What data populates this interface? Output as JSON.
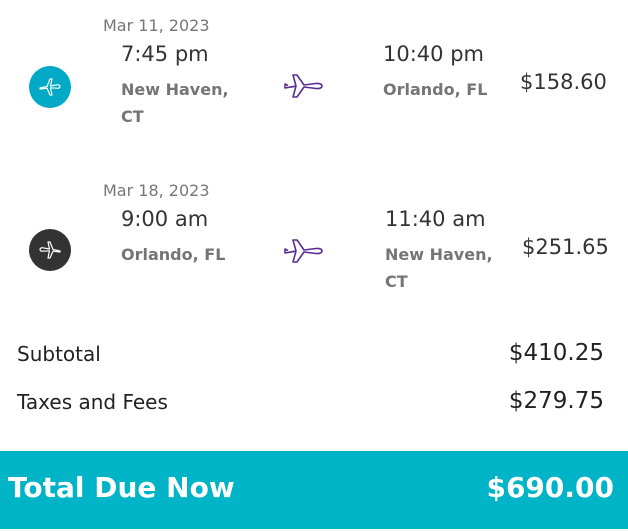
{
  "flights": [
    {
      "date": "Mar 11, 2023",
      "depart_time": "7:45 pm",
      "depart_city_line1": "New Haven,",
      "depart_city_line2": "CT",
      "arrive_time": "10:40 pm",
      "arrive_city_line1": "Orlando, FL",
      "arrive_city_line2": "",
      "price": "$158.60",
      "icon": "plane-departure-icon",
      "icon_color": "#00a9c5"
    },
    {
      "date": "Mar 18, 2023",
      "depart_time": "9:00 am",
      "depart_city_line1": "Orlando, FL",
      "depart_city_line2": "",
      "arrive_time": "11:40 am",
      "arrive_city_line1": "New Haven,",
      "arrive_city_line2": "CT",
      "price": "$251.65",
      "icon": "plane-return-icon",
      "icon_color": "#333333"
    }
  ],
  "arrow_icon": "plane-arrow-icon",
  "arrow_color": "#5a2d91",
  "summary": {
    "subtotal_label": "Subtotal",
    "subtotal_value": "$410.25",
    "taxes_label": "Taxes and Fees",
    "taxes_value": "$279.75"
  },
  "total": {
    "label": "Total Due Now",
    "value": "$690.00",
    "bar_color": "#00b4c8"
  }
}
